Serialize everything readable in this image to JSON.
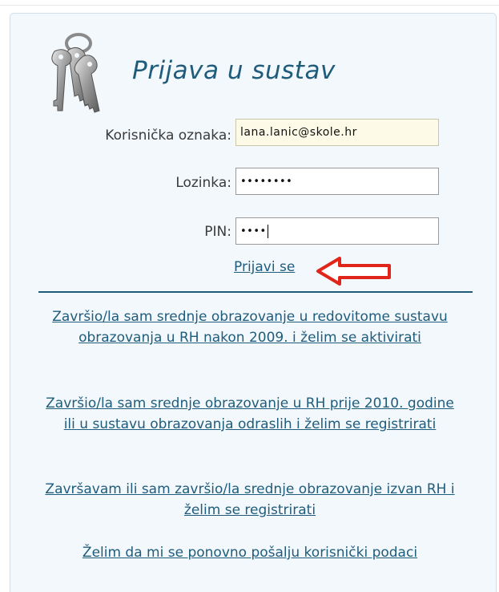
{
  "login": {
    "title": "Prijava u sustav",
    "username_label": "Korisnička oznaka:",
    "username_value": "lana.lanic@skole.hr",
    "password_label": "Lozinka:",
    "password_masked": "••••••••",
    "pin_label": "PIN:",
    "pin_masked": "••••",
    "submit_label": "Prijavi se"
  },
  "links": [
    "Završio/la sam srednje obrazovanje u redovitome sustavu obrazovanja u RH nakon 2009. i želim se aktivirati",
    "Završio/la sam srednje obrazovanje u RH prije 2010. godine ili u sustavu obrazovanja odraslih i želim se registrirati",
    "Završavam ili sam završio/la srednje obrazovanje izvan RH i želim se registrirati",
    "Želim da mi se ponovno pošalju korisnički podaci"
  ],
  "icons": {
    "keys": "keys-icon",
    "arrow": "red-arrow-left-icon"
  },
  "colors": {
    "accent": "#1f5c7c",
    "arrow": "#e0251b",
    "panel_bg": "#f3f8fc"
  }
}
